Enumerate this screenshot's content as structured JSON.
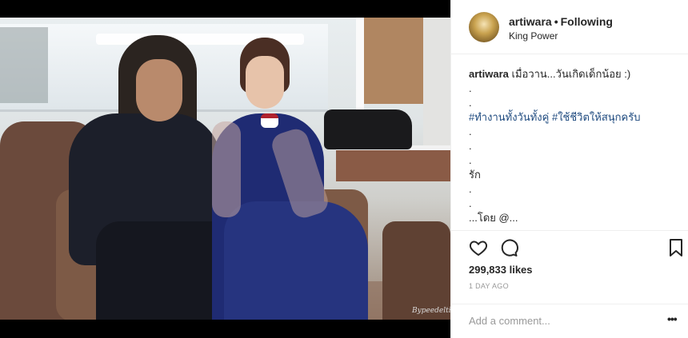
{
  "post": {
    "username": "artiwara",
    "separator": "•",
    "follow_status": "Following",
    "location": "King Power"
  },
  "caption": {
    "username": "artiwara",
    "first_line": "เมื่อวาน...วันเกิดเด็กน้อย :)",
    "dot_1": ".",
    "dot_2": ".",
    "hashtags": "#ทำงานทั้งวันทั้งคู่ #ใช้ชีวิตให้สนุกครับ",
    "dot_3": ".",
    "dot_4": ".",
    "dot_5": ".",
    "word": "รัก",
    "dot_6": ".",
    "dot_7": ".",
    "truncated_line": "...โดย @..."
  },
  "actions": {
    "likes": "299,833 likes",
    "timestamp": "1 DAY AGO"
  },
  "comment": {
    "placeholder": "Add a comment...",
    "more_label": "•••"
  },
  "photo": {
    "watermark": "Bypeedeltis"
  },
  "icons": {
    "like": "heart-icon",
    "comment": "comment-icon",
    "save": "bookmark-icon",
    "more": "more-options-icon"
  },
  "colors": {
    "hashtag": "#1e4a7f",
    "text": "#262626",
    "muted": "#999999",
    "border": "#efefef"
  }
}
